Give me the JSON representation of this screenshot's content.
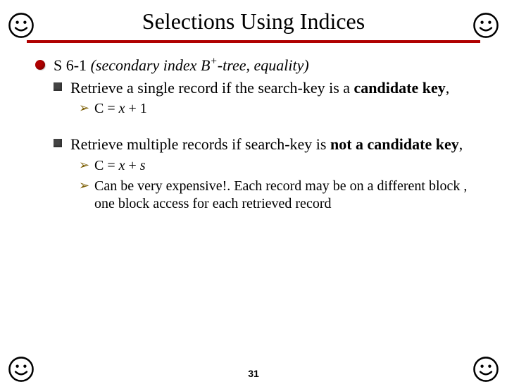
{
  "title": "Selections Using Indices",
  "page_number": "31",
  "bullets": {
    "l1_label": "S 6-1",
    "l1_desc_html": "(secondary index B<sup>+</sup>-tree, equality)",
    "l2a_html": "Retrieve a single record if the search-key is a <b>candidate key</b>,",
    "l3a_html": "C = <span class='ital'>x</span> + 1",
    "l2b_html": "Retrieve multiple records if search-key is <b>not a candidate key</b>,",
    "l3b_html": "C = <span class='ital'>x</span> + <span class='ital'>s</span>",
    "l3c_html": "Can be very expensive!. Each record may be on a different block , one block access for each retrieved record"
  }
}
